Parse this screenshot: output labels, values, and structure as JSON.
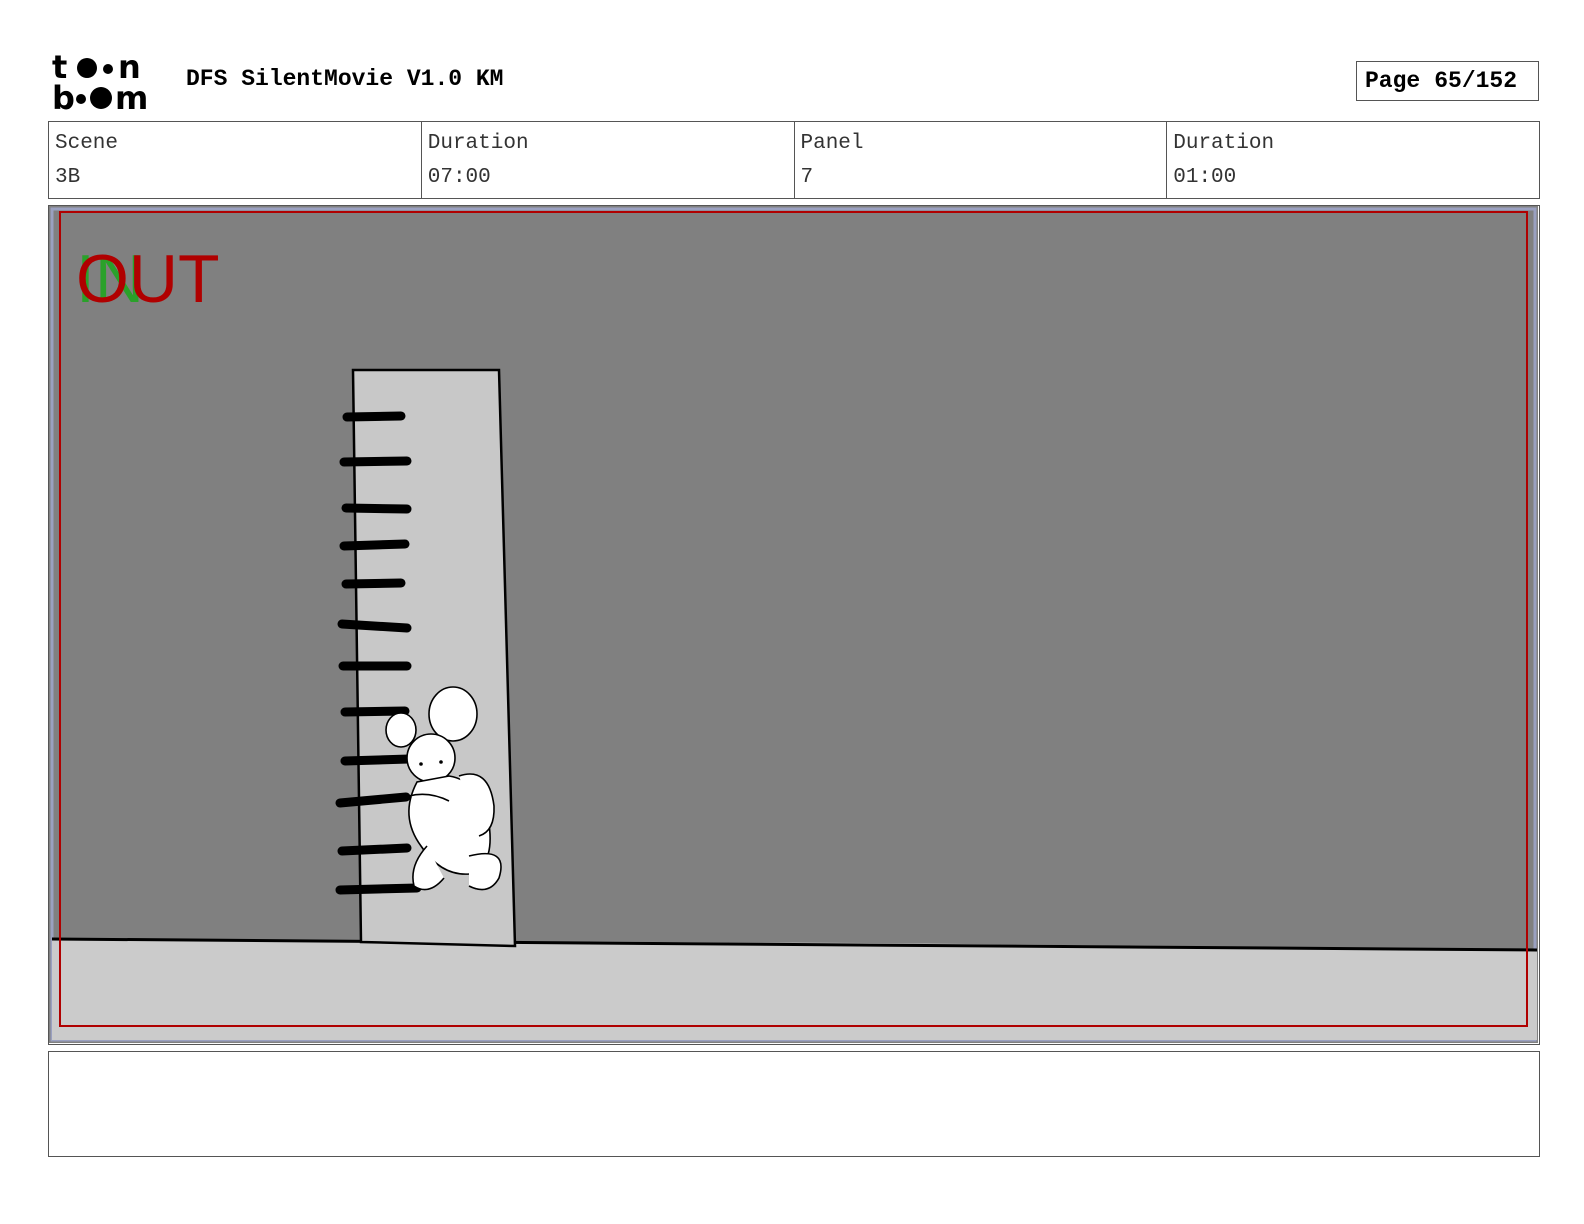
{
  "header": {
    "logo_text_top": "toon",
    "logo_text_bottom": "boom",
    "title": "DFS SilentMovie V1.0 KM",
    "page_label": "Page",
    "page_value": "65/152"
  },
  "info": {
    "scene_label": "Scene",
    "scene_value": "3B",
    "scene_duration_label": "Duration",
    "scene_duration_value": "07:00",
    "panel_label": "Panel",
    "panel_value": "7",
    "panel_duration_label": "Duration",
    "panel_duration_value": "01:00"
  },
  "panel": {
    "in_marker": "IN",
    "out_marker": "OUT",
    "colors": {
      "background": "#808080",
      "ground": "#cbcbcb",
      "safe_frame": "#b00000",
      "in_marker": "#2aa12a",
      "out_marker": "#b00000"
    }
  },
  "notes": {
    "text": ""
  }
}
